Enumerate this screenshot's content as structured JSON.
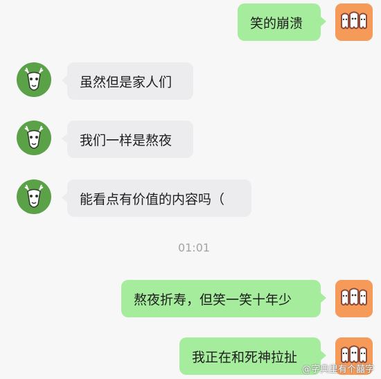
{
  "messages": [
    {
      "side": "out",
      "text": "笑的崩溃"
    },
    {
      "side": "in",
      "text": "虽然但是家人们"
    },
    {
      "side": "in",
      "text": "我们一样是熬夜"
    },
    {
      "side": "in",
      "text": "能看点有价值的内容吗（"
    },
    {
      "side": "out",
      "text": "熬夜折寿，但笑一笑十年少"
    },
    {
      "side": "out",
      "text": "我正在和死神拉扯"
    }
  ],
  "timestamp": "01:01",
  "watermark": "@字典里有个囍字",
  "colors": {
    "outgoing_bubble": "#a5ec9d",
    "incoming_bubble": "#ececee",
    "self_avatar": "#f59a59",
    "other_avatar": "#5aa147",
    "background": "#f7f7f8"
  },
  "avatars": {
    "self": "cartoon-teeth-icon",
    "other": "deer-skull-icon"
  }
}
